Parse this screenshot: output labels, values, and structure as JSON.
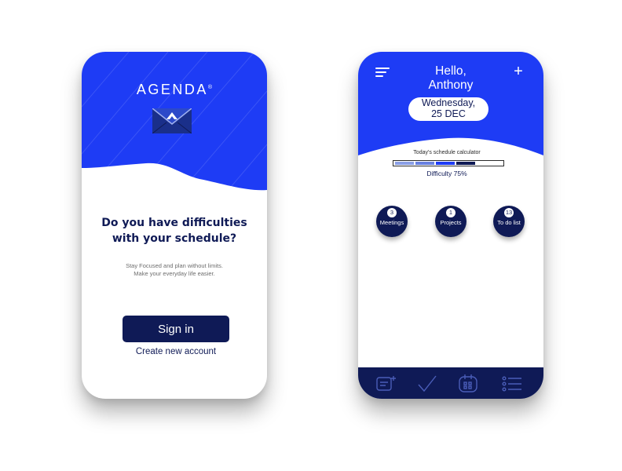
{
  "colors": {
    "primary_blue": "#1e3cf5",
    "navy": "#0f1a56",
    "white": "#ffffff"
  },
  "left_screen": {
    "logo": {
      "text": "AGENDA",
      "mark": "®",
      "icon": "envelope-logo-icon"
    },
    "question_line1": "Do you have difficulties",
    "question_line2": "with your schedule?",
    "subtitle_line1": "Stay Focused and plan without limits.",
    "subtitle_line2": "Make your everyday life easier.",
    "sign_in_label": "Sign in",
    "create_account_label": "Create new account"
  },
  "right_screen": {
    "greeting_line1": "Hello,",
    "greeting_line2": "Anthony",
    "date_line1": "Wednesday,",
    "date_line2": "25 DEC",
    "calculator_title": "Today's schedule calculator",
    "difficulty_label": "Difficulty 75%",
    "difficulty_percent": 75,
    "stats": [
      {
        "count": "3",
        "label": "Meetings"
      },
      {
        "count": "1",
        "label": "Projects"
      },
      {
        "count": "13",
        "label": "To do list"
      }
    ],
    "icons": [
      "menu-icon",
      "plus-icon",
      "add-note-icon",
      "checkmark-icon",
      "calendar-icon",
      "list-icon"
    ]
  }
}
